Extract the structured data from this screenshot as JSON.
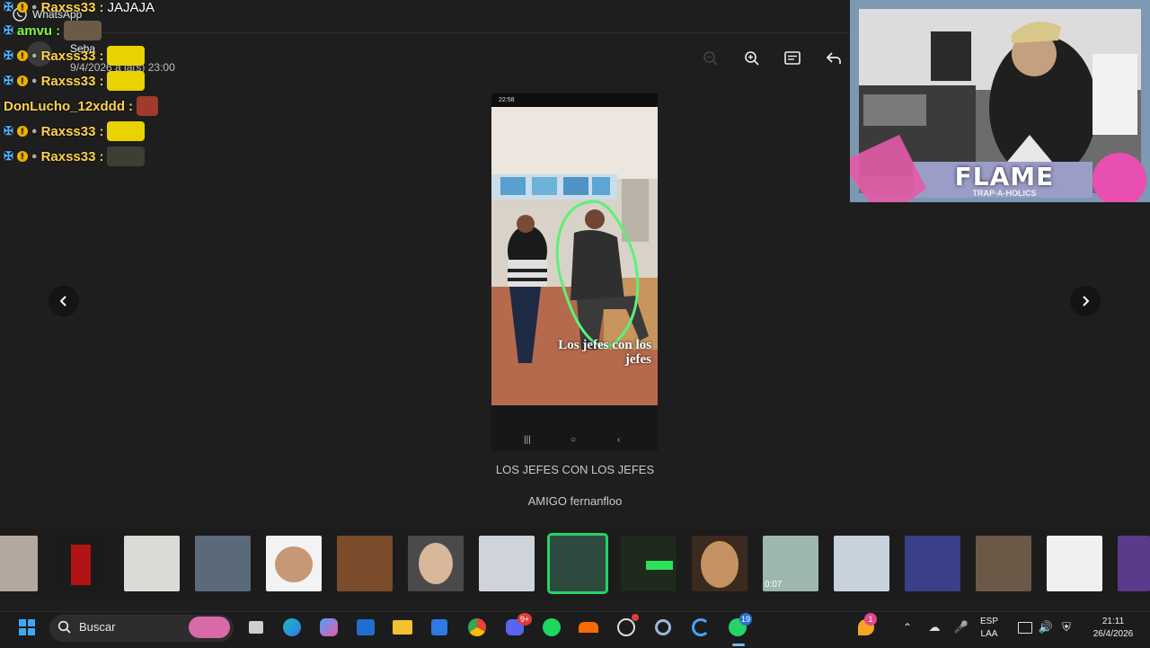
{
  "app": {
    "window_title": "WhatsApp",
    "sender_name": "Seba",
    "sender_date": "9/4/2026 a la(s) 23:00"
  },
  "chat": [
    {
      "user": "Raxss33",
      "message": "JAJAJA",
      "color": "#ffd24a"
    },
    {
      "user": "amvu",
      "message": "",
      "color": "#7cfc3a"
    },
    {
      "user": "Raxss33",
      "message": "",
      "color": "#ffd24a"
    },
    {
      "user": "Raxss33",
      "message": "",
      "color": "#ffd24a"
    },
    {
      "user": "DonLucho_12xddd",
      "message": "",
      "color": "#ffd24a"
    },
    {
      "user": "Raxss33",
      "message": "",
      "color": "#ffd24a"
    },
    {
      "user": "Raxss33",
      "message": "",
      "color": "#ffd24a"
    }
  ],
  "viewer": {
    "caption_overlay": "Los jefes con los jefes",
    "phone_time": "22:58",
    "media_title": "LOS JEFES CON LOS JEFES",
    "media_subtitle": "AMIGO fernanfloo"
  },
  "webcam": {
    "banner_title": "FLAME",
    "banner_subtitle": "TRAP-A-HOLICS"
  },
  "thumbnails": [
    {
      "label": "",
      "active": false
    },
    {
      "label": "",
      "active": false
    },
    {
      "label": "",
      "active": false
    },
    {
      "label": "",
      "active": false
    },
    {
      "label": "",
      "active": false
    },
    {
      "label": "",
      "active": false
    },
    {
      "label": "",
      "active": false
    },
    {
      "label": "",
      "active": false
    },
    {
      "label": "",
      "active": true
    },
    {
      "label": "",
      "active": false
    },
    {
      "label": "",
      "active": false
    },
    {
      "label": "0:07",
      "active": false
    },
    {
      "label": "",
      "active": false
    },
    {
      "label": "",
      "active": false
    },
    {
      "label": "",
      "active": false
    },
    {
      "label": "",
      "active": false
    }
  ],
  "taskbar": {
    "search_placeholder": "Buscar",
    "language": "ESP",
    "layout": "LAA",
    "time": "21:11",
    "date": "26/4/2026",
    "whatsapp_badge": "19",
    "discord_badge": "9+",
    "widget_badge": "1"
  },
  "colors": {
    "accent": "#25d366",
    "background": "#1e1e1e",
    "taskbar": "#1c1c1c"
  }
}
